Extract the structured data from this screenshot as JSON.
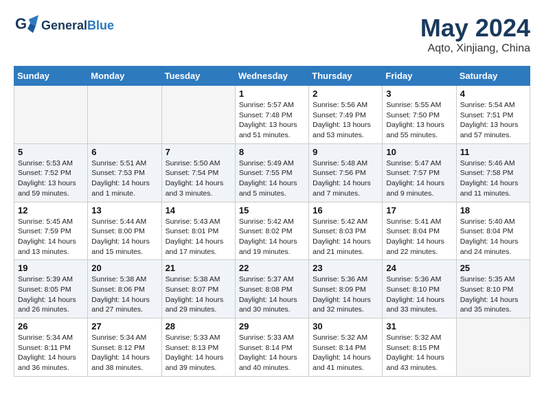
{
  "logo": {
    "line1": "General",
    "line2": "Blue"
  },
  "title": "May 2024",
  "location": "Aqto, Xinjiang, China",
  "weekdays": [
    "Sunday",
    "Monday",
    "Tuesday",
    "Wednesday",
    "Thursday",
    "Friday",
    "Saturday"
  ],
  "weeks": [
    [
      {
        "day": "",
        "content": ""
      },
      {
        "day": "",
        "content": ""
      },
      {
        "day": "",
        "content": ""
      },
      {
        "day": "1",
        "content": "Sunrise: 5:57 AM\nSunset: 7:48 PM\nDaylight: 13 hours\nand 51 minutes."
      },
      {
        "day": "2",
        "content": "Sunrise: 5:56 AM\nSunset: 7:49 PM\nDaylight: 13 hours\nand 53 minutes."
      },
      {
        "day": "3",
        "content": "Sunrise: 5:55 AM\nSunset: 7:50 PM\nDaylight: 13 hours\nand 55 minutes."
      },
      {
        "day": "4",
        "content": "Sunrise: 5:54 AM\nSunset: 7:51 PM\nDaylight: 13 hours\nand 57 minutes."
      }
    ],
    [
      {
        "day": "5",
        "content": "Sunrise: 5:53 AM\nSunset: 7:52 PM\nDaylight: 13 hours\nand 59 minutes."
      },
      {
        "day": "6",
        "content": "Sunrise: 5:51 AM\nSunset: 7:53 PM\nDaylight: 14 hours\nand 1 minute."
      },
      {
        "day": "7",
        "content": "Sunrise: 5:50 AM\nSunset: 7:54 PM\nDaylight: 14 hours\nand 3 minutes."
      },
      {
        "day": "8",
        "content": "Sunrise: 5:49 AM\nSunset: 7:55 PM\nDaylight: 14 hours\nand 5 minutes."
      },
      {
        "day": "9",
        "content": "Sunrise: 5:48 AM\nSunset: 7:56 PM\nDaylight: 14 hours\nand 7 minutes."
      },
      {
        "day": "10",
        "content": "Sunrise: 5:47 AM\nSunset: 7:57 PM\nDaylight: 14 hours\nand 9 minutes."
      },
      {
        "day": "11",
        "content": "Sunrise: 5:46 AM\nSunset: 7:58 PM\nDaylight: 14 hours\nand 11 minutes."
      }
    ],
    [
      {
        "day": "12",
        "content": "Sunrise: 5:45 AM\nSunset: 7:59 PM\nDaylight: 14 hours\nand 13 minutes."
      },
      {
        "day": "13",
        "content": "Sunrise: 5:44 AM\nSunset: 8:00 PM\nDaylight: 14 hours\nand 15 minutes."
      },
      {
        "day": "14",
        "content": "Sunrise: 5:43 AM\nSunset: 8:01 PM\nDaylight: 14 hours\nand 17 minutes."
      },
      {
        "day": "15",
        "content": "Sunrise: 5:42 AM\nSunset: 8:02 PM\nDaylight: 14 hours\nand 19 minutes."
      },
      {
        "day": "16",
        "content": "Sunrise: 5:42 AM\nSunset: 8:03 PM\nDaylight: 14 hours\nand 21 minutes."
      },
      {
        "day": "17",
        "content": "Sunrise: 5:41 AM\nSunset: 8:04 PM\nDaylight: 14 hours\nand 22 minutes."
      },
      {
        "day": "18",
        "content": "Sunrise: 5:40 AM\nSunset: 8:04 PM\nDaylight: 14 hours\nand 24 minutes."
      }
    ],
    [
      {
        "day": "19",
        "content": "Sunrise: 5:39 AM\nSunset: 8:05 PM\nDaylight: 14 hours\nand 26 minutes."
      },
      {
        "day": "20",
        "content": "Sunrise: 5:38 AM\nSunset: 8:06 PM\nDaylight: 14 hours\nand 27 minutes."
      },
      {
        "day": "21",
        "content": "Sunrise: 5:38 AM\nSunset: 8:07 PM\nDaylight: 14 hours\nand 29 minutes."
      },
      {
        "day": "22",
        "content": "Sunrise: 5:37 AM\nSunset: 8:08 PM\nDaylight: 14 hours\nand 30 minutes."
      },
      {
        "day": "23",
        "content": "Sunrise: 5:36 AM\nSunset: 8:09 PM\nDaylight: 14 hours\nand 32 minutes."
      },
      {
        "day": "24",
        "content": "Sunrise: 5:36 AM\nSunset: 8:10 PM\nDaylight: 14 hours\nand 33 minutes."
      },
      {
        "day": "25",
        "content": "Sunrise: 5:35 AM\nSunset: 8:10 PM\nDaylight: 14 hours\nand 35 minutes."
      }
    ],
    [
      {
        "day": "26",
        "content": "Sunrise: 5:34 AM\nSunset: 8:11 PM\nDaylight: 14 hours\nand 36 minutes."
      },
      {
        "day": "27",
        "content": "Sunrise: 5:34 AM\nSunset: 8:12 PM\nDaylight: 14 hours\nand 38 minutes."
      },
      {
        "day": "28",
        "content": "Sunrise: 5:33 AM\nSunset: 8:13 PM\nDaylight: 14 hours\nand 39 minutes."
      },
      {
        "day": "29",
        "content": "Sunrise: 5:33 AM\nSunset: 8:14 PM\nDaylight: 14 hours\nand 40 minutes."
      },
      {
        "day": "30",
        "content": "Sunrise: 5:32 AM\nSunset: 8:14 PM\nDaylight: 14 hours\nand 41 minutes."
      },
      {
        "day": "31",
        "content": "Sunrise: 5:32 AM\nSunset: 8:15 PM\nDaylight: 14 hours\nand 43 minutes."
      },
      {
        "day": "",
        "content": ""
      }
    ]
  ]
}
